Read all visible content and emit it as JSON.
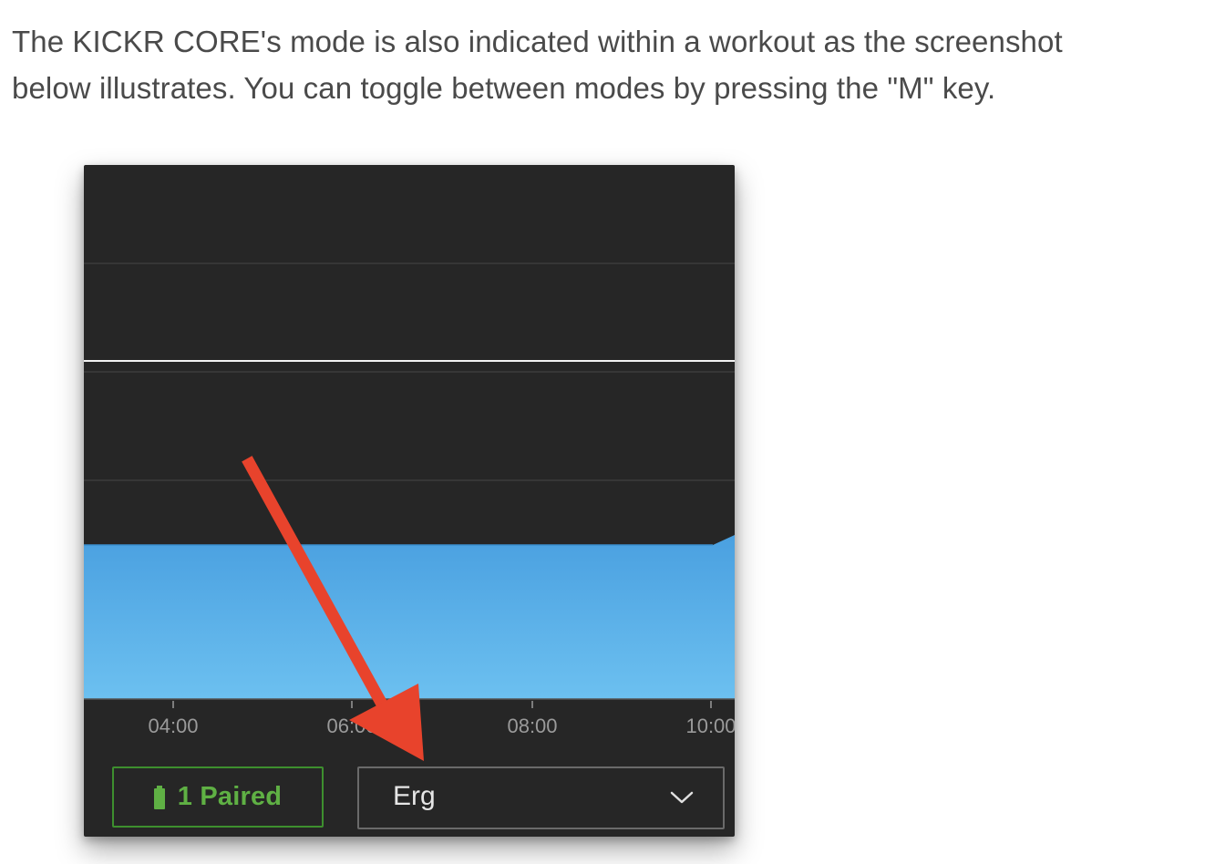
{
  "article": {
    "line1": "The KICKR CORE's mode is also indicated within a workout as the screenshot",
    "line2": "below illustrates. You can toggle between modes by pressing the \"M\" key."
  },
  "workout": {
    "x_ticks": [
      "04:00",
      "06:00",
      "08:00",
      "10:00"
    ],
    "paired_label": "1 Paired",
    "mode_value": "Erg",
    "colors": {
      "background": "#262626",
      "area_top": "#4aa0e0",
      "area_bottom": "#6cc0f0",
      "paired_green": "#5fb044",
      "annotation_arrow": "#e8432c"
    }
  }
}
